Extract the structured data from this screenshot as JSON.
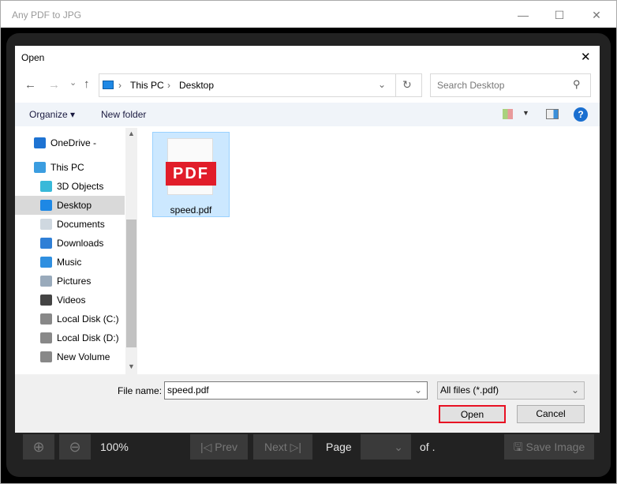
{
  "app": {
    "title": "Any PDF to JPG",
    "minimize": "—",
    "maximize": "☐",
    "close": "✕"
  },
  "dialog": {
    "title": "Open",
    "close": "✕",
    "nav": {
      "back": "←",
      "forward": "→",
      "recent": "⌄",
      "up": "↑",
      "refresh": "↻"
    },
    "breadcrumb": [
      "This PC",
      "Desktop"
    ],
    "search_placeholder": "Search Desktop",
    "toolbar": {
      "organize": "Organize ▾",
      "new_folder": "New folder",
      "help": "?"
    },
    "sidebar": [
      {
        "label": "OneDrive - Person",
        "icon": "cloud-icon",
        "color": "#1e73d2"
      },
      {
        "label": "This PC",
        "icon": "computer-icon",
        "color": "#3b9de0"
      },
      {
        "label": "3D Objects",
        "icon": "cube-icon",
        "color": "#38b9d9"
      },
      {
        "label": "Desktop",
        "icon": "desktop-icon",
        "color": "#1e88e5",
        "selected": true
      },
      {
        "label": "Documents",
        "icon": "document-icon",
        "color": "#cfd8e0"
      },
      {
        "label": "Downloads",
        "icon": "download-icon",
        "color": "#2f7fd6"
      },
      {
        "label": "Music",
        "icon": "music-icon",
        "color": "#2f8fe0"
      },
      {
        "label": "Pictures",
        "icon": "pictures-icon",
        "color": "#9ab"
      },
      {
        "label": "Videos",
        "icon": "videos-icon",
        "color": "#444"
      },
      {
        "label": "Local Disk (C:)",
        "icon": "drive-icon",
        "color": "#888"
      },
      {
        "label": "Local Disk (D:)",
        "icon": "drive-icon",
        "color": "#888"
      },
      {
        "label": "New Volume (E:)",
        "icon": "drive-icon",
        "color": "#888"
      }
    ],
    "files": [
      {
        "name": "speed.pdf",
        "badge": "PDF"
      }
    ],
    "file_name_label": "File name:",
    "file_name_value": "speed.pdf",
    "file_type": "All files (*.pdf)",
    "open": "Open",
    "cancel": "Cancel"
  },
  "viewer": {
    "zoom": "100%",
    "prev": "Prev",
    "next": "Next",
    "page_label": "Page",
    "of": "of .",
    "save": "Save Image"
  },
  "colors": {
    "accent": "#0078d7",
    "highlight_border": "#e81123",
    "pdf_red": "#e11d2a"
  }
}
